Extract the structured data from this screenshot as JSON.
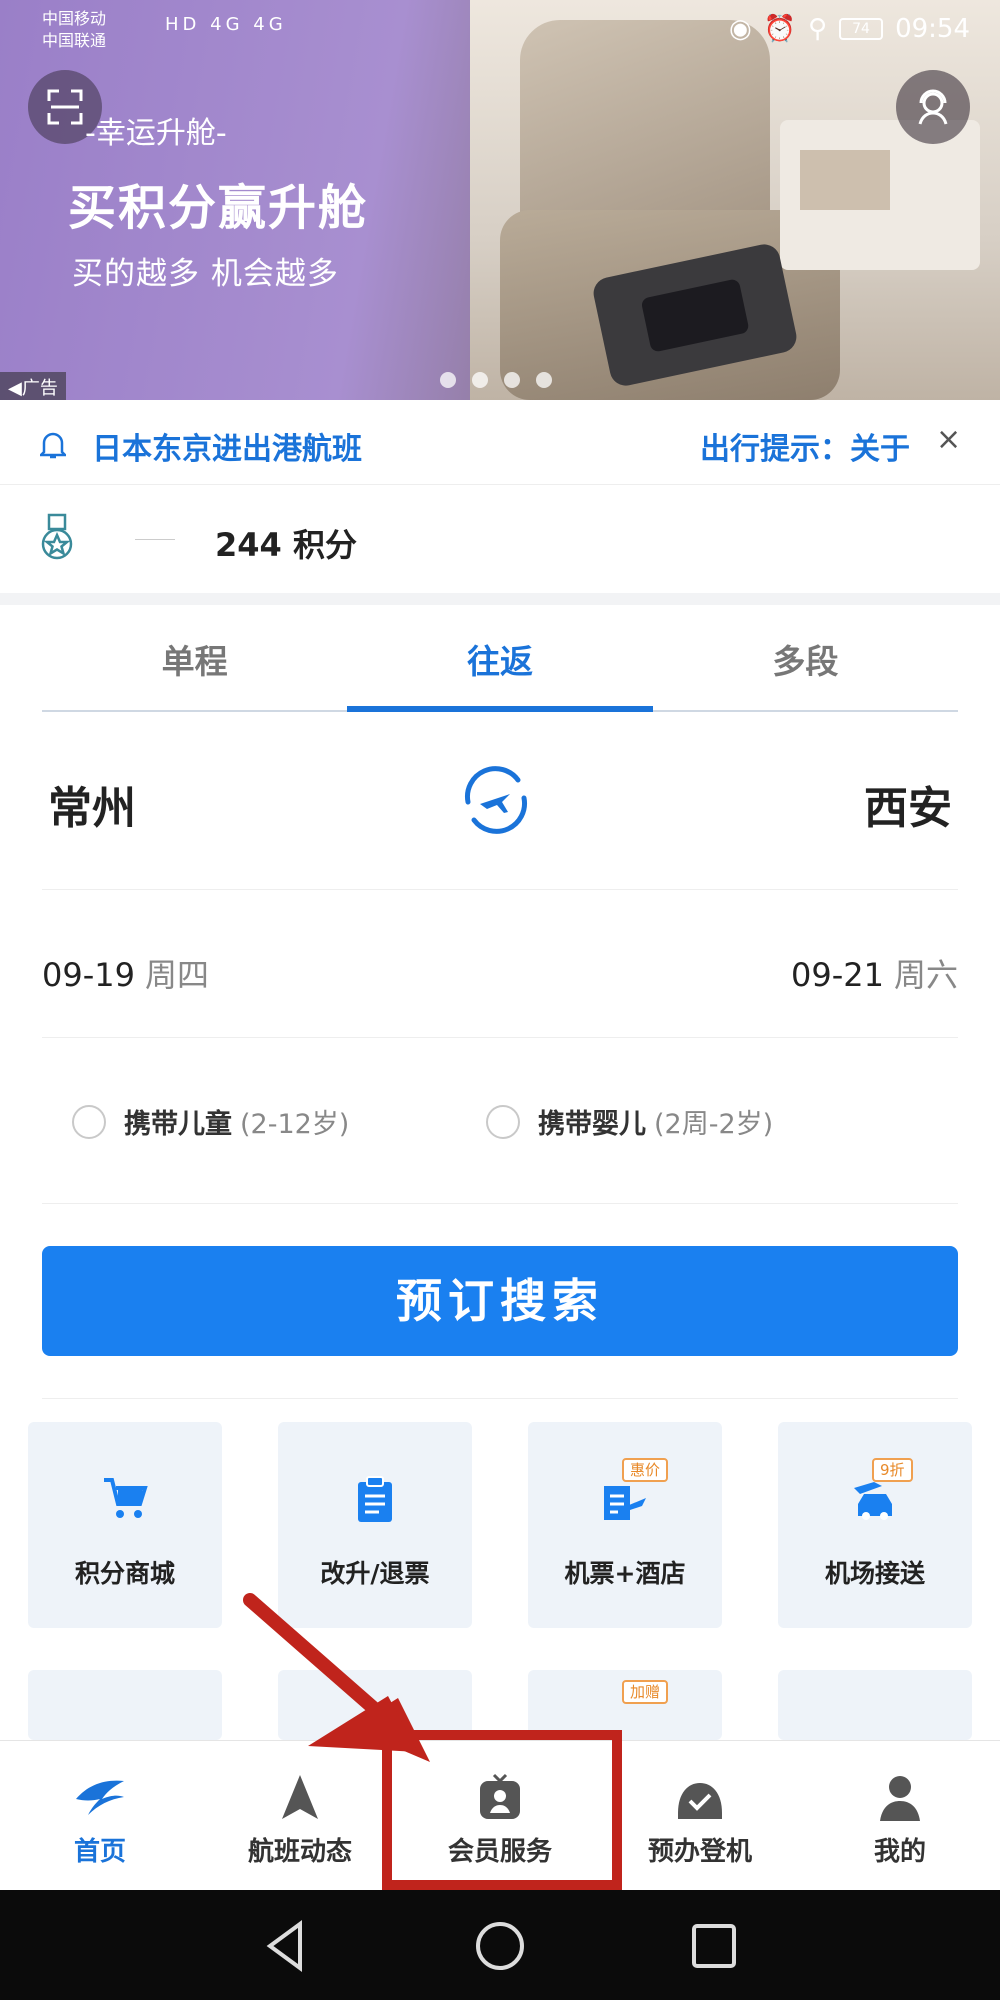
{
  "status_bar": {
    "carrier_1": "中国移动",
    "carrier_2": "中国联通",
    "network": "HD 4G 4G",
    "battery": "74",
    "time": "09:54"
  },
  "banner": {
    "tag": "-幸运升舱-",
    "title": "买积分赢升舱",
    "subtitle": "买的越多 机会越多",
    "ad_label": "广告",
    "slide_count": 4
  },
  "notice": {
    "text": "日本东京进出港航班",
    "tip": "出行提示：关于",
    "close": "×"
  },
  "points": {
    "value": "244 积分"
  },
  "tabs": [
    {
      "label": "单程",
      "active": false
    },
    {
      "label": "往返",
      "active": true
    },
    {
      "label": "多段",
      "active": false
    }
  ],
  "route": {
    "from": "常州",
    "to": "西安"
  },
  "dates": {
    "depart": "09-19",
    "depart_week": "周四",
    "return": "09-21",
    "return_week": "周六"
  },
  "options": {
    "child_label": "携带儿童",
    "child_age": "(2-12岁)",
    "infant_label": "携带婴儿",
    "infant_age": "(2周-2岁)"
  },
  "search_button": "预订搜索",
  "services": [
    {
      "label": "积分商城",
      "icon": "cart-icon",
      "badge": ""
    },
    {
      "label": "改升/退票",
      "icon": "clipboard-icon",
      "badge": ""
    },
    {
      "label": "机票+酒店",
      "icon": "plane-hotel-icon",
      "badge": "惠价"
    },
    {
      "label": "机场接送",
      "icon": "car-icon",
      "badge": "9折"
    }
  ],
  "services_row2_badge": "加赠",
  "bottom_nav": [
    {
      "label": "首页",
      "icon": "swallow-logo-icon",
      "active": true
    },
    {
      "label": "航班动态",
      "icon": "navigation-arrow-icon",
      "active": false
    },
    {
      "label": "会员服务",
      "icon": "member-card-icon",
      "active": false
    },
    {
      "label": "预办登机",
      "icon": "checkin-icon",
      "active": false
    },
    {
      "label": "我的",
      "icon": "user-icon",
      "active": false
    }
  ],
  "colors": {
    "primary": "#1a73d9",
    "button": "#1a80f0",
    "highlight": "#c0241c"
  }
}
